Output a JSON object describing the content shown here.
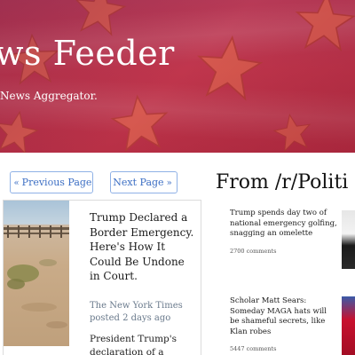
{
  "header": {
    "title": "ws Feeder",
    "subtitle": "News Aggregator."
  },
  "pagination": {
    "prev_label": "Previous Page",
    "next_label": "Next Page",
    "prev_icon": "chevron-left-double-icon",
    "next_icon": "chevron-right-double-icon"
  },
  "article": {
    "title": "Trump Declared a Border Emergency. Here's How It Could Be Undone in Court.",
    "source": "The New York Times",
    "posted": "posted 2 days ago",
    "description": "President Trump's declaration of a"
  },
  "reddit": {
    "heading": "From /r/Politi",
    "posts": [
      {
        "title": "Trump spends day two of national emergency golfing, snagging an omelette",
        "comments": "2700 comments"
      },
      {
        "title": "Scholar Matt Sears: Someday MAGA hats will be shameful secrets, like Klan robes",
        "comments": "5447 comments"
      }
    ]
  },
  "colors": {
    "banner": "#c0364d",
    "button_border": "#8fb1e6",
    "button_text": "#3d6fc4",
    "source_text": "#6a7a8c"
  }
}
